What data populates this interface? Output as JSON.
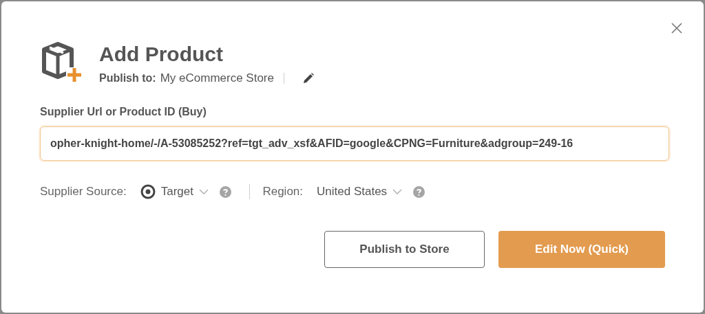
{
  "dialog": {
    "title": "Add Product",
    "publish_to": {
      "label": "Publish to:",
      "value": "My eCommerce Store"
    }
  },
  "supplier_field": {
    "label": "Supplier Url or Product ID (Buy)",
    "value": "opher-knight-home/-/A-53085252?ref=tgt_adv_xsf&AFID=google&CPNG=Furniture&adgroup=249-16"
  },
  "supplier_source": {
    "label": "Supplier Source:",
    "value": "Target"
  },
  "region": {
    "label": "Region:",
    "value": "United States"
  },
  "buttons": [
    {
      "label": "Publish to Store",
      "kind": "secondary"
    },
    {
      "label": "Edit Now (Quick)",
      "kind": "primary"
    }
  ]
}
